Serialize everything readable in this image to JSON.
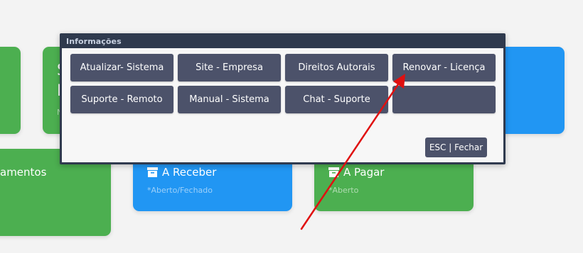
{
  "colors": {
    "green": "#4caf50",
    "blue": "#2196f3",
    "dialog_frame": "#2f3a4e",
    "button": "#4c526a",
    "arrow": "#e01010"
  },
  "cards": {
    "top_left_partial": {},
    "top_second": {
      "char1": "S",
      "char2": "I",
      "sub": "N"
    },
    "top_right_blue": {},
    "bottom_left": {
      "title": "amentos"
    },
    "receber": {
      "icon": "archive-box-icon",
      "title": "A Receber",
      "sub": "*Aberto/Fechado"
    },
    "pagar": {
      "icon": "archive-box-icon",
      "title": "A Pagar",
      "sub": "*Aberto"
    }
  },
  "dialog": {
    "title": "Informações",
    "buttons": [
      "Atualizar- Sistema",
      "Site - Empresa",
      "Direitos Autorais",
      "Renovar - Licença",
      "Suporte - Remoto",
      "Manual - Sistema",
      "Chat - Suporte",
      ""
    ],
    "esc_label": "ESC | Fechar"
  }
}
